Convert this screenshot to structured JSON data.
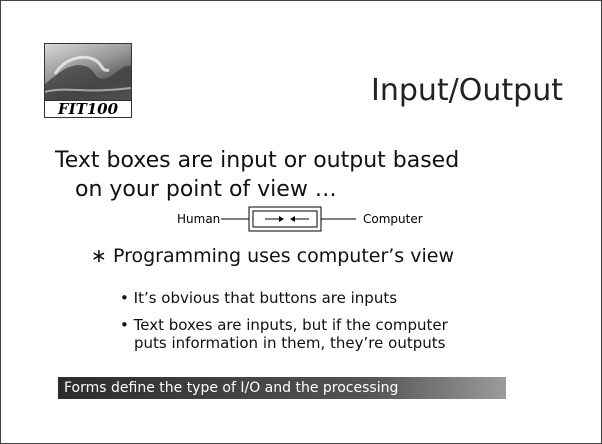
{
  "logo": {
    "text": "FIT100"
  },
  "title": "Input/Output",
  "intro": {
    "line1": "Text boxes are input or output based",
    "line2": "on your point of view …"
  },
  "diagram": {
    "left_label": "Human",
    "right_label": "Computer"
  },
  "bullet": {
    "marker": "∗",
    "text": "Programming uses computer’s view"
  },
  "subbullets": [
    {
      "marker": "•",
      "text": "It’s obvious that buttons are inputs"
    },
    {
      "marker": "•",
      "text": "Text boxes are inputs, but if the computer",
      "continuation": "puts information in them, they’re outputs"
    }
  ],
  "banner": "Forms define the type of I/O and the processing"
}
